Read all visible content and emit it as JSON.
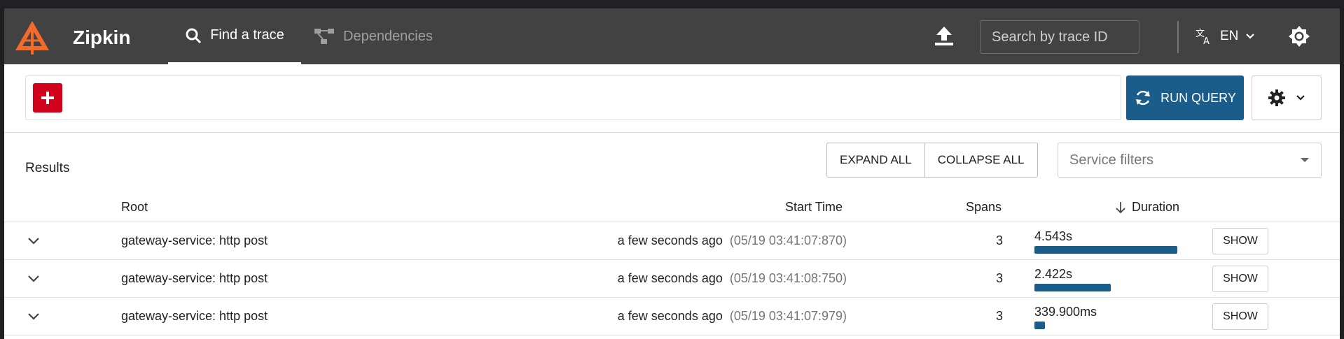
{
  "header": {
    "brand": "Zipkin",
    "nav": {
      "find_trace": "Find a trace",
      "dependencies": "Dependencies"
    },
    "search_placeholder": "Search by trace ID",
    "language": "EN"
  },
  "query": {
    "run_label": "RUN QUERY"
  },
  "results": {
    "title": "Results",
    "expand_all": "EXPAND ALL",
    "collapse_all": "COLLAPSE ALL",
    "service_filters": "Service filters",
    "columns": {
      "root": "Root",
      "start_time": "Start Time",
      "spans": "Spans",
      "duration": "Duration"
    },
    "rows": [
      {
        "root": "gateway-service: http post",
        "start_relative": "a few seconds ago",
        "start_absolute": "(05/19 03:41:07:870)",
        "spans": "3",
        "duration": "4.543s",
        "duration_fraction": 1.0,
        "action": "SHOW"
      },
      {
        "root": "gateway-service: http post",
        "start_relative": "a few seconds ago",
        "start_absolute": "(05/19 03:41:08:750)",
        "spans": "3",
        "duration": "2.422s",
        "duration_fraction": 0.533,
        "action": "SHOW"
      },
      {
        "root": "gateway-service: http post",
        "start_relative": "a few seconds ago",
        "start_absolute": "(05/19 03:41:07:979)",
        "spans": "3",
        "duration": "339.900ms",
        "duration_fraction": 0.075,
        "action": "SHOW"
      }
    ]
  },
  "colors": {
    "header_bg": "#424242",
    "accent_red": "#d0021b",
    "accent_blue": "#1a5d8a",
    "logo_orange": "#f26b2a"
  }
}
